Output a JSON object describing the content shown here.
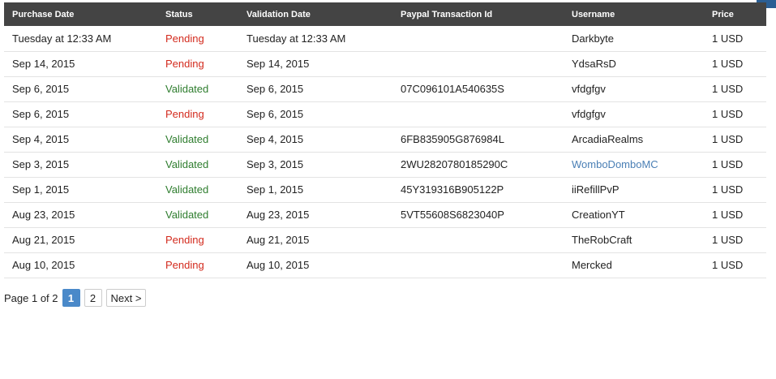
{
  "table": {
    "headers": {
      "purchase_date": "Purchase Date",
      "status": "Status",
      "validation_date": "Validation Date",
      "paypal_id": "Paypal Transaction Id",
      "username": "Username",
      "price": "Price"
    },
    "rows": [
      {
        "purchase_date": "Tuesday at 12:33 AM",
        "status": "Pending",
        "validation_date": "Tuesday at 12:33 AM",
        "paypal_id": "",
        "username": "Darkbyte",
        "price": "1 USD"
      },
      {
        "purchase_date": "Sep 14, 2015",
        "status": "Pending",
        "validation_date": "Sep 14, 2015",
        "paypal_id": "",
        "username": "YdsaRsD",
        "price": "1 USD"
      },
      {
        "purchase_date": "Sep 6, 2015",
        "status": "Validated",
        "validation_date": "Sep 6, 2015",
        "paypal_id": "07C096101A540635S",
        "username": "vfdgfgv",
        "price": "1 USD"
      },
      {
        "purchase_date": "Sep 6, 2015",
        "status": "Pending",
        "validation_date": "Sep 6, 2015",
        "paypal_id": "",
        "username": "vfdgfgv",
        "price": "1 USD"
      },
      {
        "purchase_date": "Sep 4, 2015",
        "status": "Validated",
        "validation_date": "Sep 4, 2015",
        "paypal_id": "6FB835905G876984L",
        "username": "ArcadiaRealms",
        "price": "1 USD"
      },
      {
        "purchase_date": "Sep 3, 2015",
        "status": "Validated",
        "validation_date": "Sep 3, 2015",
        "paypal_id": "2WU2820780185290C",
        "username": "WomboDomboMC",
        "price": "1 USD"
      },
      {
        "purchase_date": "Sep 1, 2015",
        "status": "Validated",
        "validation_date": "Sep 1, 2015",
        "paypal_id": "45Y319316B905122P",
        "username": "iiRefillPvP",
        "price": "1 USD"
      },
      {
        "purchase_date": "Aug 23, 2015",
        "status": "Validated",
        "validation_date": "Aug 23, 2015",
        "paypal_id": "5VT55608S6823040P",
        "username": "CreationYT",
        "price": "1 USD"
      },
      {
        "purchase_date": "Aug 21, 2015",
        "status": "Pending",
        "validation_date": "Aug 21, 2015",
        "paypal_id": "",
        "username": "TheRobCraft",
        "price": "1 USD"
      },
      {
        "purchase_date": "Aug 10, 2015",
        "status": "Pending",
        "validation_date": "Aug 10, 2015",
        "paypal_id": "",
        "username": "Mercked",
        "price": "1 USD"
      }
    ]
  },
  "pagination": {
    "info": "Page 1 of 2",
    "pages": [
      "1",
      "2"
    ],
    "current": "1",
    "next_label": "Next >"
  },
  "colors": {
    "header_bg": "#444444",
    "pending": "#d32b1e",
    "validated": "#2e7d2e",
    "link": "#4a7fb5",
    "active_page": "#4a89c9"
  }
}
